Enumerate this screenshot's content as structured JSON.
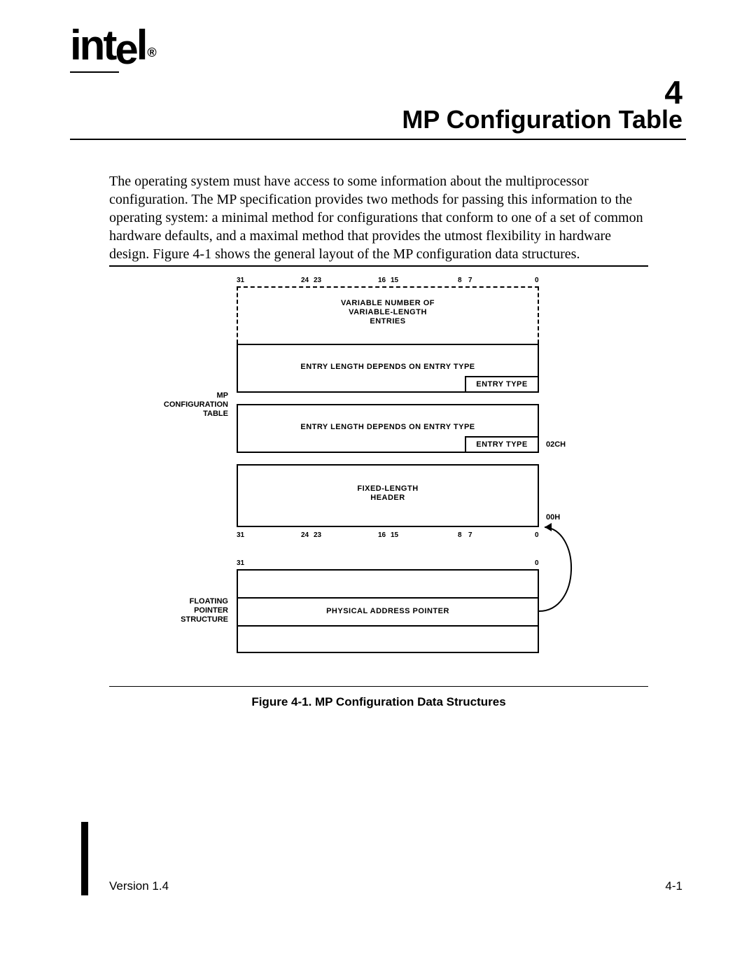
{
  "logo_text": "intel",
  "chapter_number": "4",
  "chapter_title": "MP Configuration Table",
  "paragraph": "The operating system must have access to some information about the multiprocessor configuration.  The MP specification provides two methods for passing this information to the operating system: a minimal method for configurations that conform to one of a set of common hardware defaults, and a maximal method that provides the utmost flexibility in hardware design.  Figure 4-1 shows the general layout of the MP configuration data structures.",
  "figure_caption": "Figure 4-1.  MP Configuration Data Structures",
  "footer_version": "Version 1.4",
  "footer_page": "4-1",
  "diagram": {
    "bits": {
      "b31": "31",
      "b24": "24",
      "b23": "23",
      "b16": "16",
      "b15": "15",
      "b8": "8",
      "b7": "7",
      "b0": "0"
    },
    "variable_entries": "VARIABLE NUMBER OF\nVARIABLE-LENGTH\nENTRIES",
    "entry_len": "ENTRY LENGTH DEPENDS ON ENTRY TYPE",
    "entry_type": "ENTRY TYPE",
    "fixed_header": "FIXED-LENGTH\nHEADER",
    "left_label_mp": "MP\nCONFIGURATION\nTABLE",
    "left_label_fp": "FLOATING\nPOINTER\nSTRUCTURE",
    "addr_02ch": "02CH",
    "addr_00h": "00H",
    "phys_ptr": "PHYSICAL ADDRESS POINTER"
  }
}
